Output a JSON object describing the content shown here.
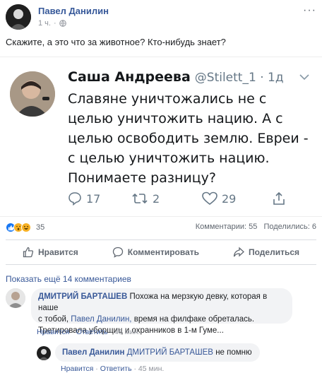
{
  "post": {
    "author": "Павел Данилин",
    "time": "1 ч.",
    "more_label": "···",
    "text": "Скажите, а это что за животное? Кто-нибудь знает?"
  },
  "tweet": {
    "author": "Саша Андреева",
    "handle": "@Stilett_1 · 1д",
    "lines": [
      "Славяне уничтожались не с",
      "целью уничтожить нацию. А с",
      "целью освободить землю. Евреи -",
      "с целью уничтожить нацию.",
      "Понимаете разницу?"
    ],
    "replies": "17",
    "retweets": "2",
    "likes": "29"
  },
  "stats": {
    "reactions_count": "35",
    "comments": "Комментарии: 55",
    "shares": "Поделились: 6"
  },
  "actions": {
    "like": "Нравится",
    "comment": "Комментировать",
    "share": "Поделиться"
  },
  "comments": {
    "view_more": "Показать ещё 14 комментариев",
    "c1": {
      "author": "ДМИТРИЙ БАРТАШЕВ",
      "text_a": "Похожа на мерзкую девку, которая в наше",
      "text_b": "с тобой,",
      "mention": "Павел Данилин,",
      "text_c": "время на филфаке обреталась.",
      "text_d": "Третировала уборщиц и охранников в 1-м Гуме...",
      "like": "Нравится",
      "reply": "Ответить",
      "time": "46 мин."
    },
    "c2": {
      "author": "Павел Данилин",
      "mention": "ДМИТРИЙ БАРТАШЕВ",
      "text": "не помню",
      "like": "Нравится",
      "reply": "Ответить",
      "time": "45 мин."
    }
  },
  "colors": {
    "link_blue": "#385898",
    "text": "#1c1e21",
    "muted": "#90949c",
    "like_blue": "#1877f2"
  }
}
